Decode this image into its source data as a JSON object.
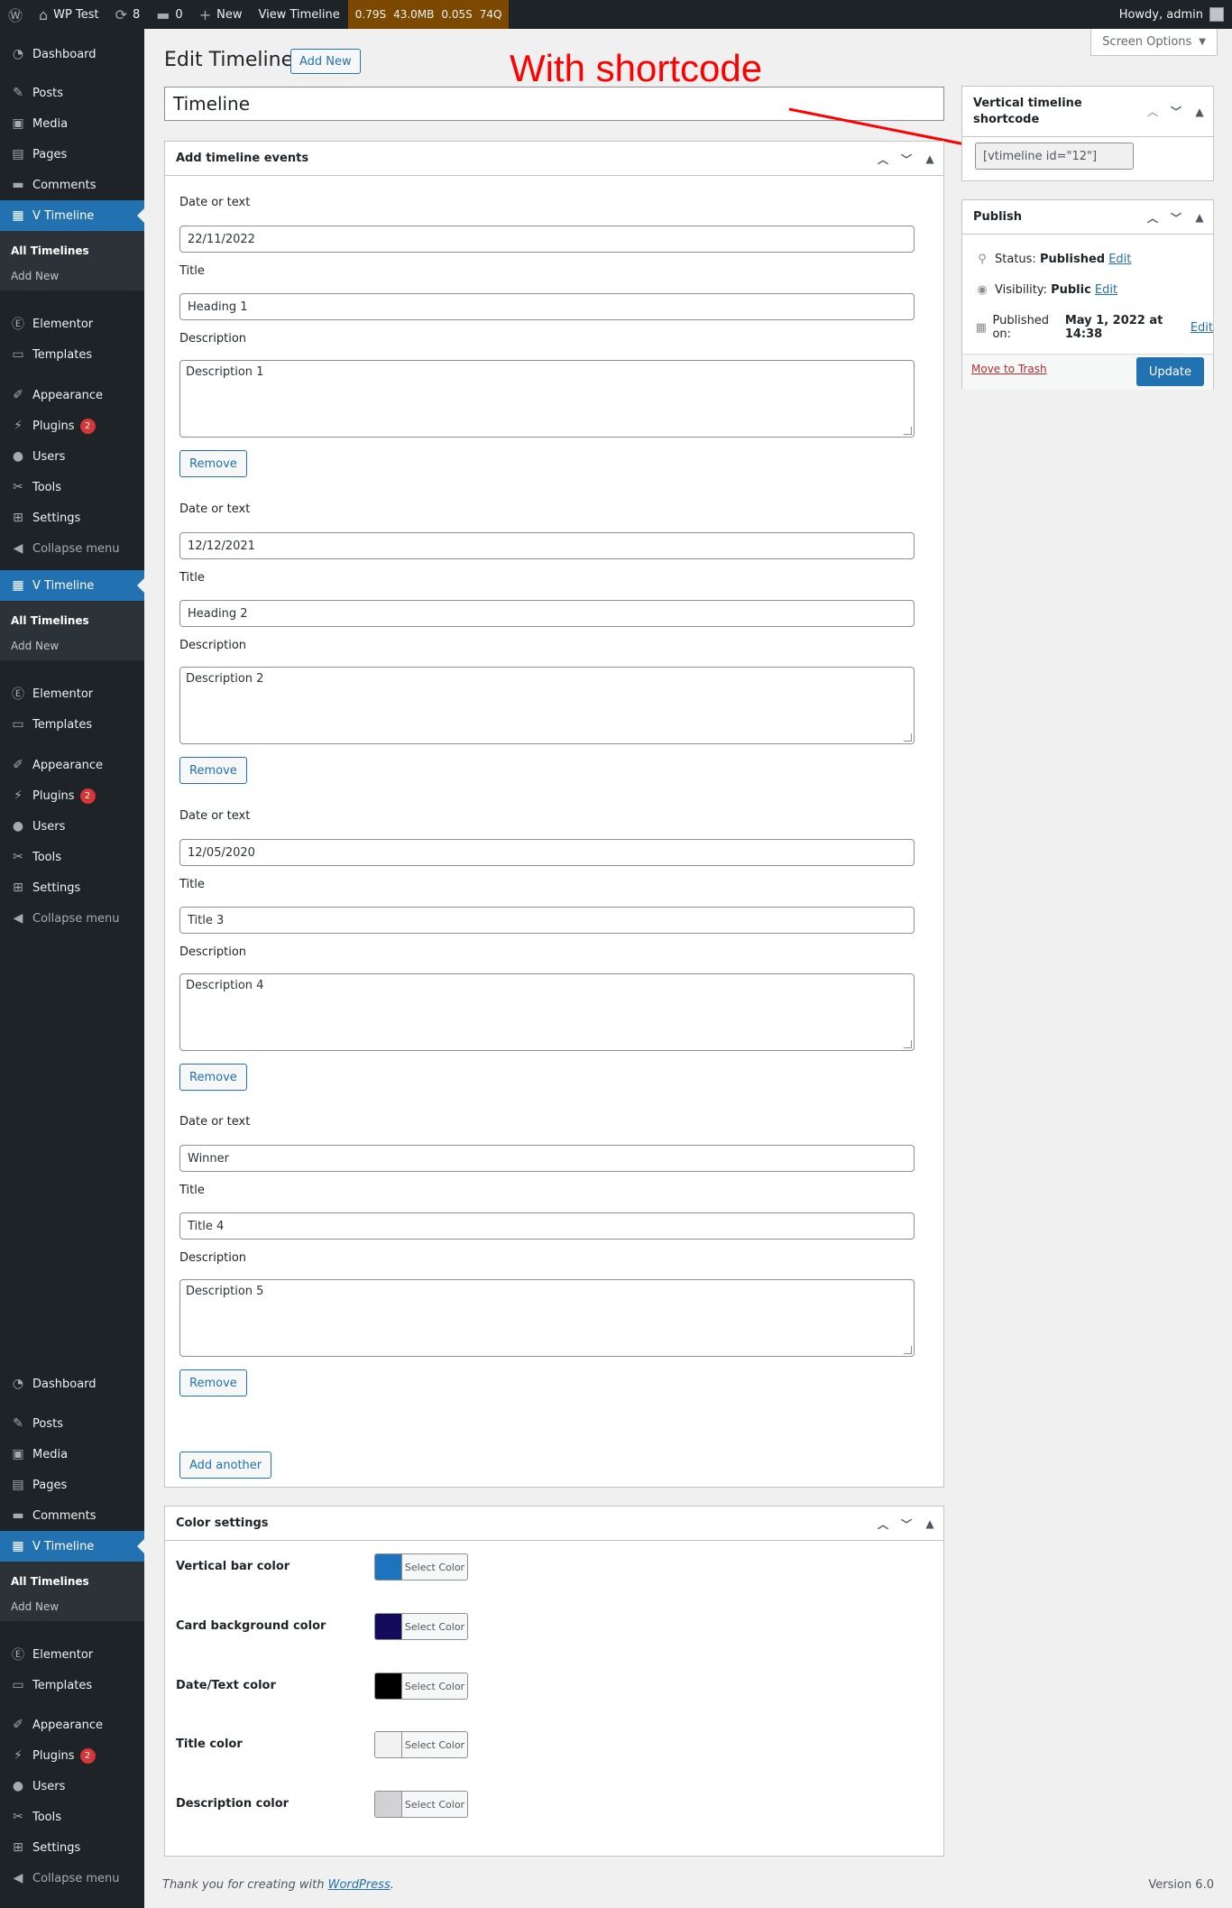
{
  "admin_bar": {
    "site_name": "WP Test",
    "updates_count": "8",
    "comments_count": "0",
    "new_label": "New",
    "view_label": "View Timeline",
    "qm_time": "0.79S",
    "qm_memory": "43.0MB",
    "qm_db": "0.05S",
    "qm_queries": "74Q",
    "howdy": "Howdy, admin"
  },
  "sidebar_groups": [
    {
      "dashboard": "Dashboard",
      "posts": "Posts",
      "media": "Media",
      "pages": "Pages",
      "comments": "Comments",
      "vtimeline": "V Timeline",
      "all_timelines": "All Timelines",
      "add_new": "Add New",
      "elementor": "Elementor",
      "templates": "Templates",
      "appearance": "Appearance",
      "plugins": "Plugins",
      "plugins_badge": "2",
      "users": "Users",
      "tools": "Tools",
      "settings": "Settings",
      "collapse": "Collapse menu"
    }
  ],
  "header": {
    "page_title": "Edit Timeline",
    "add_new": "Add New",
    "screen_options": "Screen Options"
  },
  "annotation": "With shortcode",
  "post_title": "Timeline",
  "events_box": {
    "title": "Add timeline events",
    "date_label": "Date or text",
    "title_label": "Title",
    "description_label": "Description",
    "remove_label": "Remove",
    "add_another": "Add another",
    "events": [
      {
        "date": "22/11/2022",
        "title": "Heading 1",
        "description": "Description 1"
      },
      {
        "date": "12/12/2021",
        "title": "Heading 2",
        "description": "Description 2"
      },
      {
        "date": "12/05/2020",
        "title": "Title 3",
        "description": "Description 4"
      },
      {
        "date": "Winner",
        "title": "Title 4",
        "description": "Description 5"
      }
    ]
  },
  "color_box": {
    "title": "Color settings",
    "select_label": "Select Color",
    "rows": [
      {
        "label": "Vertical bar color",
        "color": "#1e73be"
      },
      {
        "label": "Card background color",
        "color": "#140b5d"
      },
      {
        "label": "Date/Text color",
        "color": "#000000"
      },
      {
        "label": "Title color",
        "color": "#f2f2f2"
      },
      {
        "label": "Description color",
        "color": "#d2d2d4"
      }
    ]
  },
  "shortcode_box": {
    "title": "Vertical timeline shortcode",
    "shortcode": "[vtimeline id=\"12\"]"
  },
  "publish_box": {
    "title": "Publish",
    "status_label": "Status:",
    "status_value": "Published",
    "visibility_label": "Visibility:",
    "visibility_value": "Public",
    "published_label": "Published on:",
    "published_value": "May 1, 2022 at 14:38",
    "edit": "Edit",
    "trash": "Move to Trash",
    "update": "Update"
  },
  "footer": {
    "thanks": "Thank you for creating with",
    "wp_link": "WordPress",
    "version": "Version 6.0"
  },
  "colors": {
    "admin_bar_bg": "#1d2327",
    "accent": "#2271b1",
    "annotation": "#ff0000"
  }
}
